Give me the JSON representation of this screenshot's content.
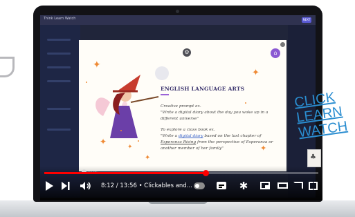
{
  "app": {
    "topbar_brand": "Think Learn Watch",
    "topbar_button": "NEXT"
  },
  "slide": {
    "heading": "ENGLISH LANGUAGE ARTS",
    "prompt_intro": "Creative prompt ex.",
    "prompt_quote": "\"Write a digital diary about the day you woke up in a different universe\"",
    "explore_intro": "To explore a class book ex.",
    "explore_pre": "\"Write a ",
    "explore_link": "digital diary",
    "explore_mid": " based on the last chapter of ",
    "explore_book": "Esperanza Rising",
    "explore_post": " from the perspective of Esperanza or another member of her family\"",
    "home_icon": "home-icon",
    "genially_label": "genially"
  },
  "player": {
    "time_current": "8:12",
    "time_total": "13:56",
    "time_separator": " / ",
    "chapter": "Clickables and...",
    "chapter_chevron": "›",
    "progress_fraction": 0.589,
    "accent_color": "#ff0000"
  },
  "overlay_words": [
    "CLICK",
    "LEARN",
    "WATCH"
  ],
  "colors": {
    "slide_bg": "#fffdf8",
    "heading": "#37306b",
    "overlay": "#2a8dd0"
  }
}
